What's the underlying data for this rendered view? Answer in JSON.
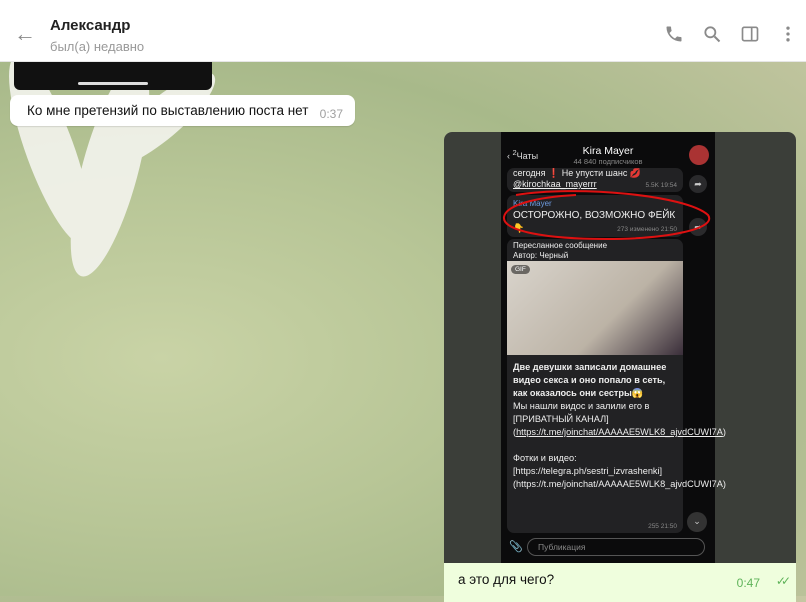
{
  "header": {
    "name": "Александр",
    "status": "был(а) недавно"
  },
  "messages": {
    "incoming": {
      "text": "Ко мне претензий по выставлению поста нет",
      "time": "0:37"
    },
    "outgoing": {
      "caption": "а это для чего?",
      "time": "0:47"
    }
  },
  "screenshot": {
    "back": "Чаты",
    "unread": "2",
    "title": "Kira Mayer",
    "subtitle": "44 840 подписчиков",
    "prev_text": "сегодня ❗ Не упусти шанс 💋",
    "prev_link": "@kirochkaa_mayerrr",
    "prev_meta": "5.5K 19:54",
    "warn_author": "Kira Mayer",
    "warn_text": "ОСТОРОЖНО, ВОЗМОЖНО ФЕЙК",
    "warn_emoji": "👇",
    "warn_meta": "273 изменено 21:50",
    "fwd_label": "Пересланное сообщение",
    "fwd_author": "Автор: Черный",
    "gif_label": "GIF",
    "post_bold": "Две девушки записали домашнее видео секса и оно попало в сеть, как оказалось они сестры😱",
    "post_l1": "Мы нашли видос и залили его в [ПРИВАТНЫЙ КАНАЛ](",
    "post_link1": "https://t.me/joinchat/AAAAAE5WLK8_ajvdCUWI7A",
    "post_l2": ")",
    "post_l3": "Фотки и видео: [https://telegra.ph/sestri_izvrashenki](https://t.me/joinchat/AAAAAE5WLK8_ajvdCUWI7A)",
    "post_meta": "255 21:50",
    "input_placeholder": "Публикация"
  }
}
